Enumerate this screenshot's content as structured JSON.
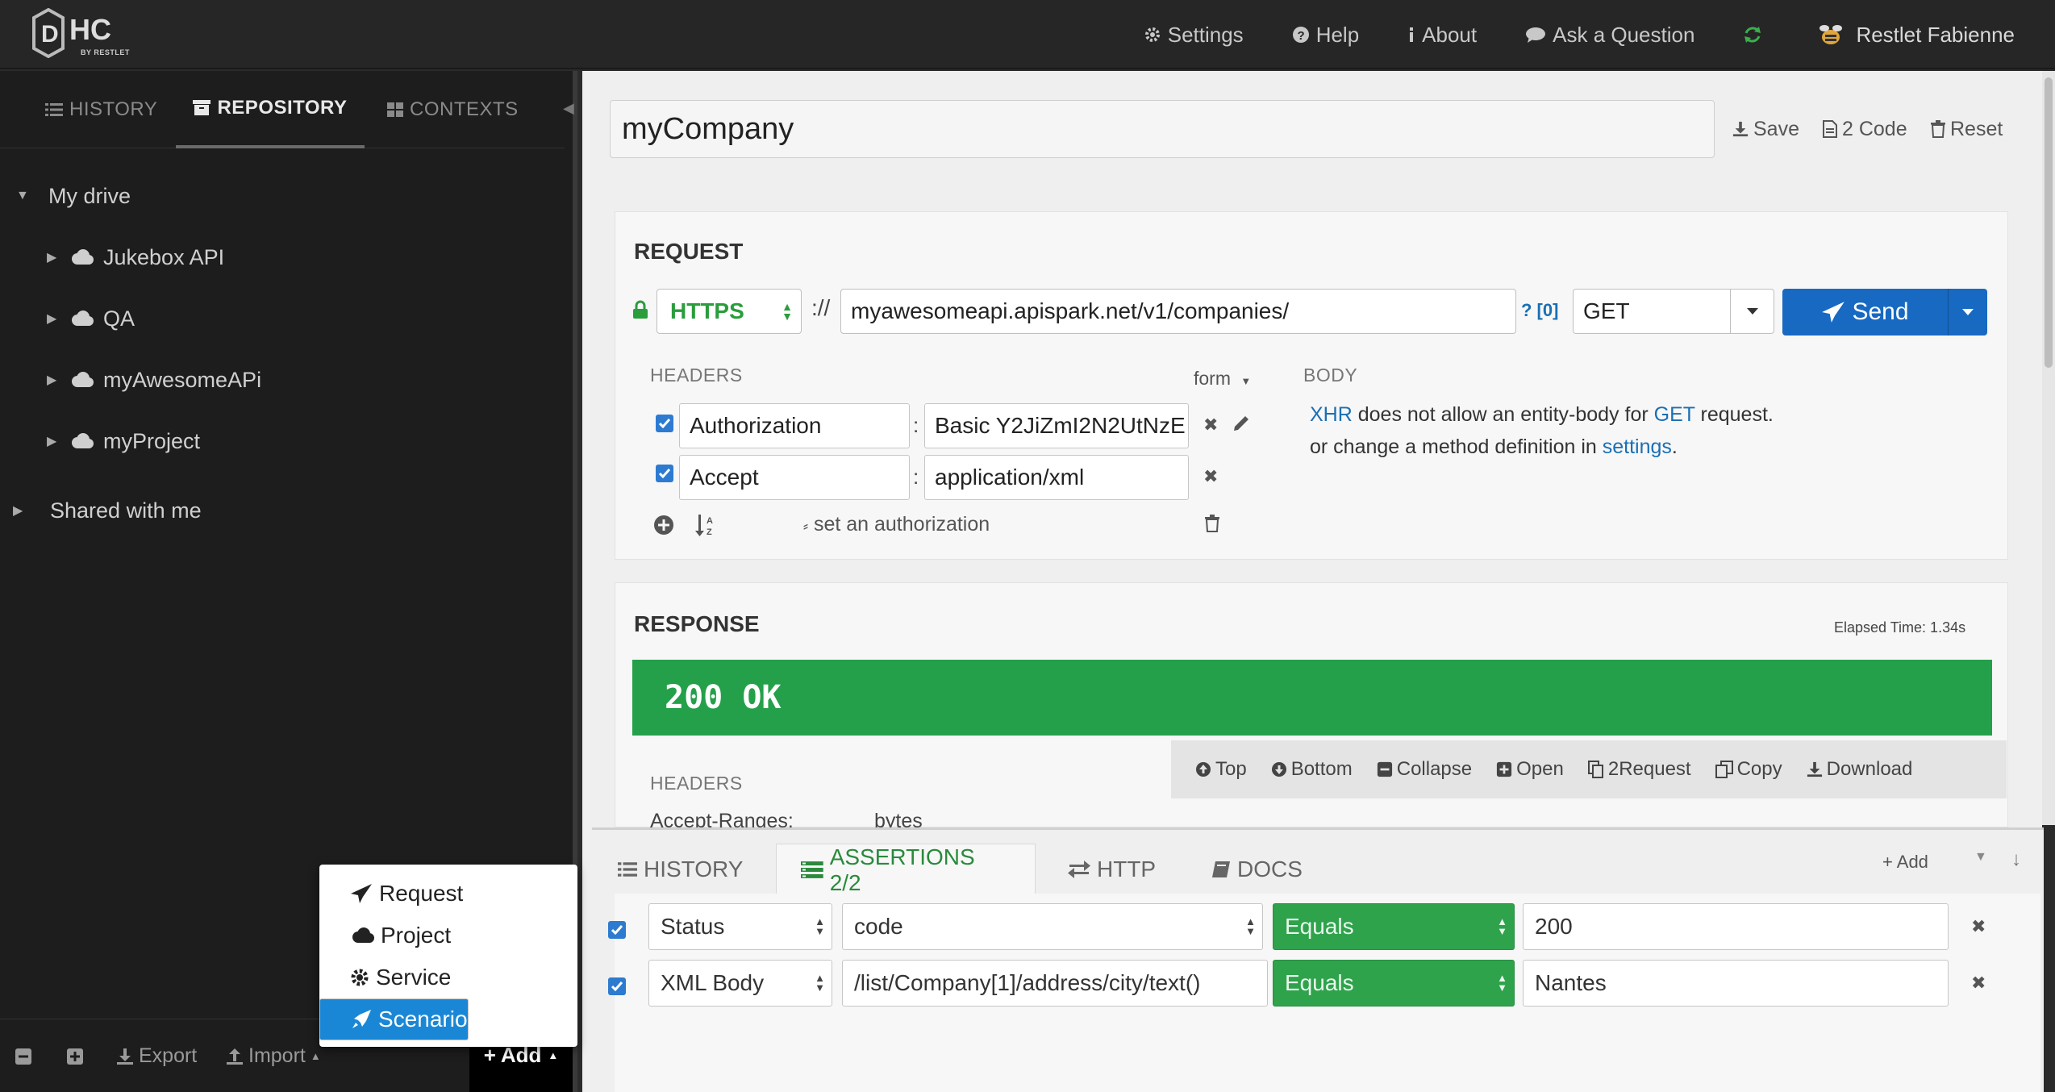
{
  "topbar": {
    "logo_text": "HC",
    "logo_sub": "BY RESTLET",
    "nav": [
      "Settings",
      "Help",
      "About",
      "Ask a Question"
    ],
    "user": "Restlet Fabienne"
  },
  "sidebar": {
    "tabs": [
      "HISTORY",
      "REPOSITORY",
      "CONTEXTS"
    ],
    "my_drive": "My drive",
    "projects": [
      "Jukebox API",
      "QA",
      "myAwesomeAPi",
      "myProject"
    ],
    "shared": "Shared with me",
    "bottom": {
      "export": "Export",
      "import": "Import",
      "add": "Add"
    },
    "add_menu": [
      "Request",
      "Project",
      "Service",
      "Scenario"
    ]
  },
  "main": {
    "request_name": "myCompany",
    "actions": {
      "save": "Save",
      "code": "2 Code",
      "reset": "Reset"
    },
    "request": {
      "title": "REQUEST",
      "protocol": "HTTPS",
      "sep": "://",
      "url": "myawesomeapi.apispark.net/v1/companies/",
      "qlink": "? [0]",
      "method": "GET",
      "send": "Send",
      "headers_label": "HEADERS",
      "form_label": "form",
      "headers": [
        {
          "name": "Authorization",
          "value": "Basic Y2JiZmI2N2UtNzE"
        },
        {
          "name": "Accept",
          "value": "application/xml"
        }
      ],
      "set_auth": "set an authorization",
      "body_label": "BODY",
      "body_xhr": "XHR",
      "body_line1_mid": " does not allow an entity-body for ",
      "body_get": "GET",
      "body_line1_end": " request.",
      "body_line2_start": "or change a method definition in ",
      "body_settings": "settings",
      "body_line2_end": "."
    },
    "response": {
      "title": "RESPONSE",
      "elapsed": "Elapsed Time: 1.34s",
      "status": "200 OK",
      "headers_label": "HEADERS",
      "partial_header": "Accept-Ranges:",
      "partial_value": "bytes",
      "toolbar": [
        "Top",
        "Bottom",
        "Collapse",
        "Open",
        "2Request",
        "Copy",
        "Download"
      ]
    }
  },
  "bottom": {
    "tabs": [
      "HISTORY",
      "ASSERTIONS 2/2",
      "HTTP",
      "DOCS"
    ],
    "add": "Add",
    "assertions": [
      {
        "type": "Status",
        "path": "code",
        "op": "Equals",
        "value": "200"
      },
      {
        "type": "XML Body",
        "path": "/list/Company[1]/address/city/text()",
        "op": "Equals",
        "value": "Nantes"
      }
    ]
  }
}
